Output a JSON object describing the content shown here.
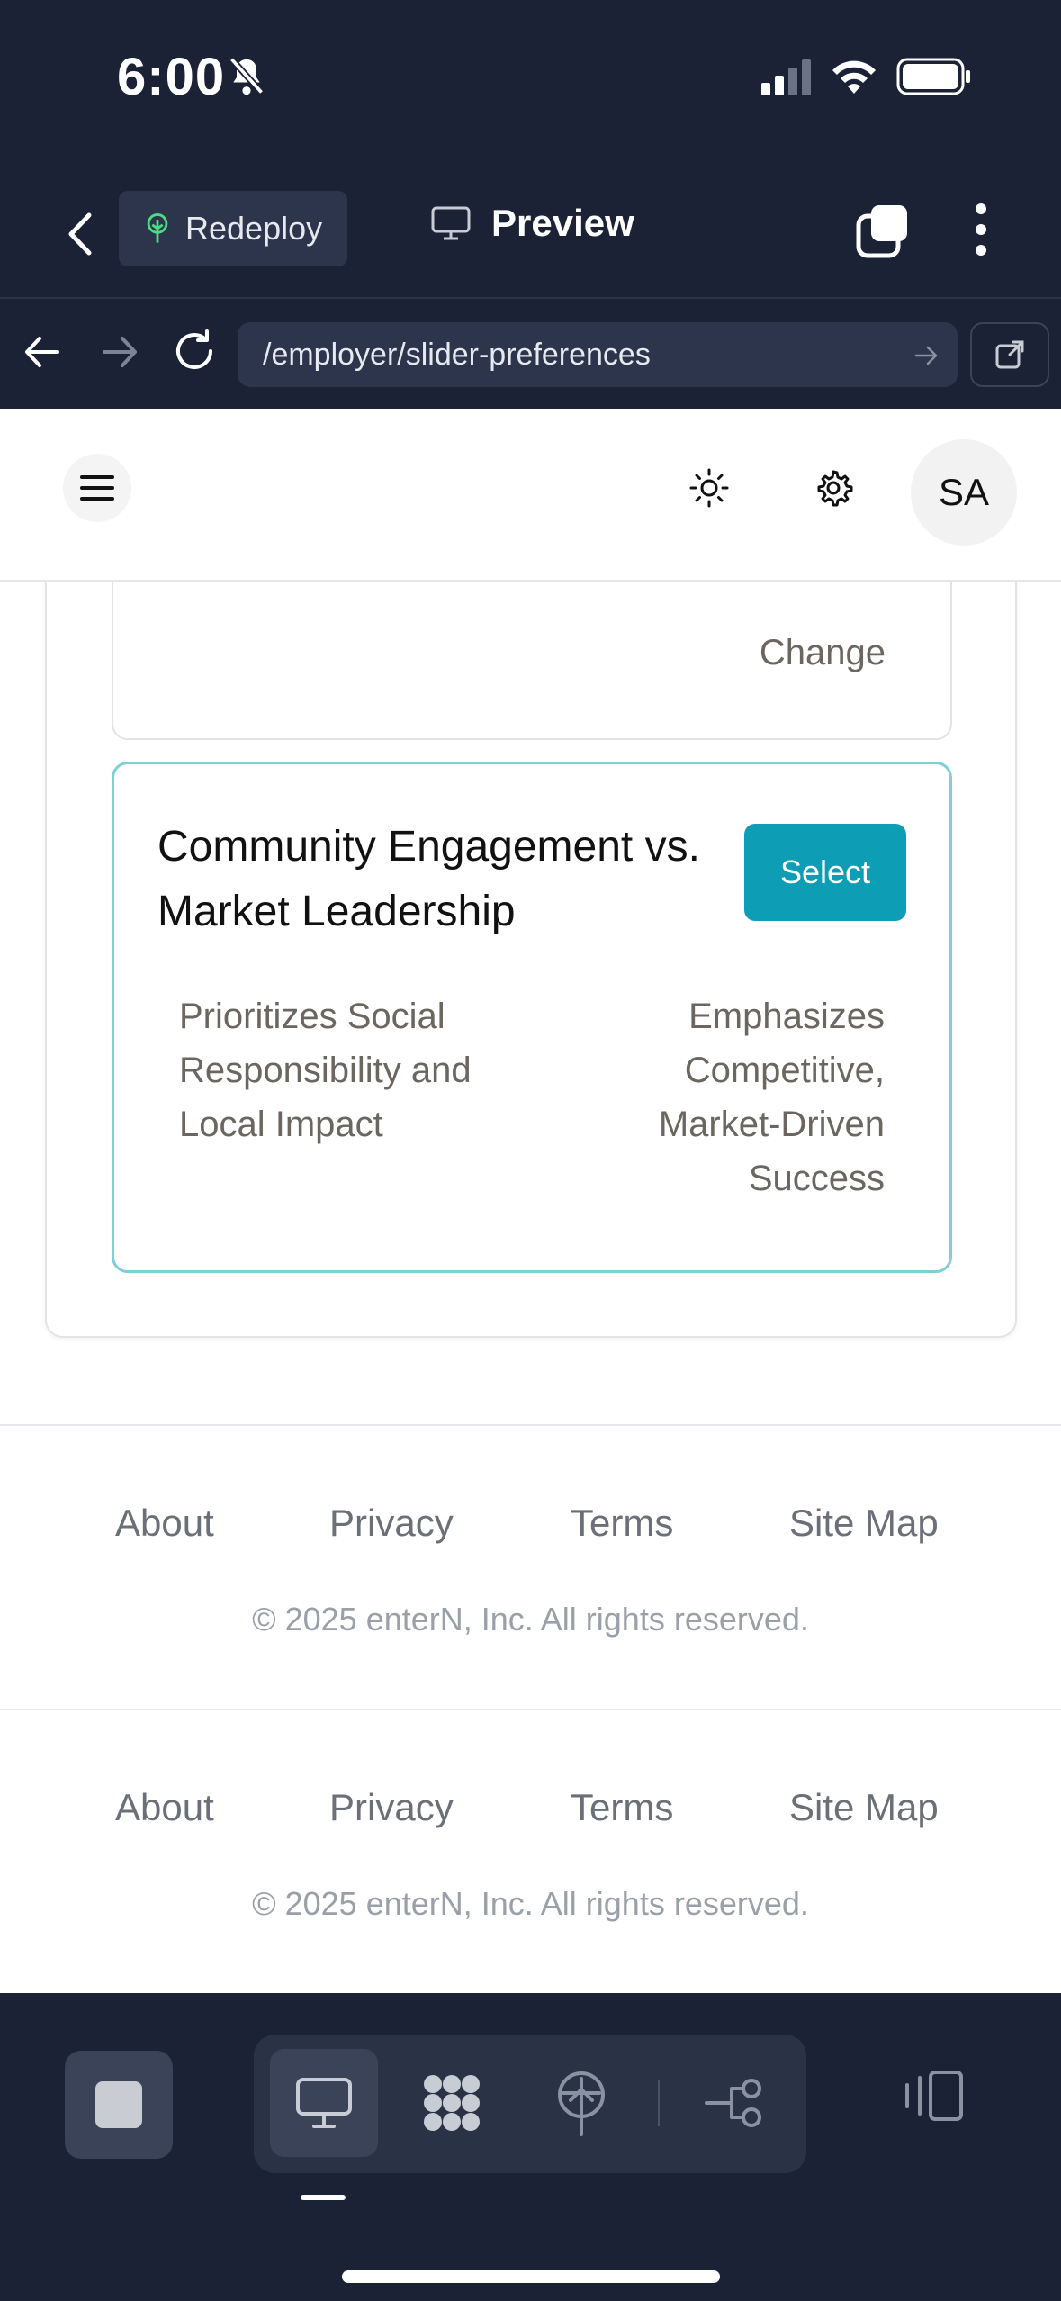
{
  "status_bar": {
    "time": "6:00"
  },
  "toolbar": {
    "redeploy_label": "Redeploy",
    "preview_label": "Preview"
  },
  "browser": {
    "url": "/employer/slider-preferences"
  },
  "header": {
    "avatar_initials": "SA"
  },
  "previous_card": {
    "right_text": "Change"
  },
  "slider_card": {
    "title": "Community Engagement vs. Market Leadership",
    "select_label": "Select",
    "left_label": "Prioritizes Social Responsibility and Local Impact",
    "right_label": "Emphasizes Competitive, Market-Driven Success"
  },
  "footers": [
    {
      "links": [
        "About",
        "Privacy",
        "Terms",
        "Site Map"
      ],
      "copyright": "© 2025 enterN, Inc. All rights reserved."
    },
    {
      "links": [
        "About",
        "Privacy",
        "Terms",
        "Site Map"
      ],
      "copyright": "© 2025 enterN, Inc. All rights reserved."
    }
  ],
  "colors": {
    "accent": "#0d9db5",
    "card_border": "#7fcfd8",
    "chrome_bg": "#1b2236"
  },
  "icons": [
    "bell-slash-icon",
    "signal-icon",
    "wifi-icon",
    "battery-icon",
    "chevron-left-icon",
    "tree-icon",
    "monitor-icon",
    "tabs-icon",
    "more-vertical-icon",
    "arrow-left-icon",
    "arrow-right-icon",
    "reload-icon",
    "external-link-icon",
    "menu-icon",
    "sun-icon",
    "gear-icon",
    "stop-icon",
    "desktop-icon",
    "dots-grid-icon",
    "deploy-icon",
    "flow-icon",
    "panel-icon"
  ]
}
